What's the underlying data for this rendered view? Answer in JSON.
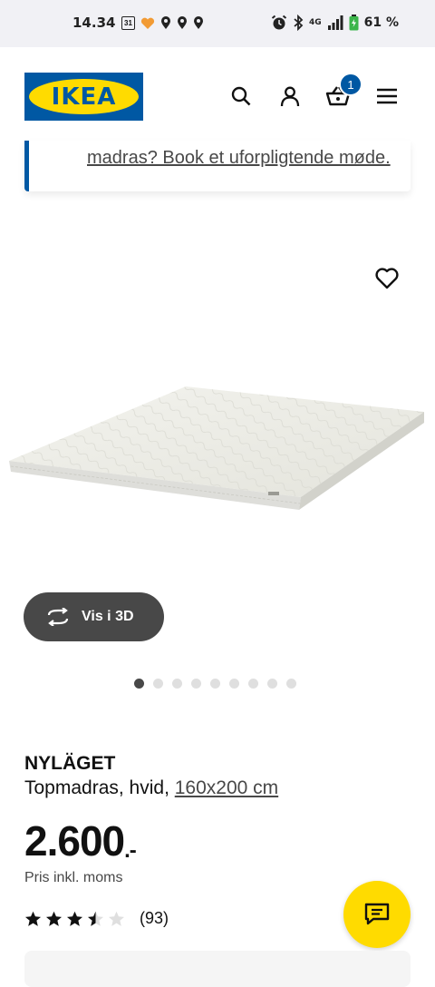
{
  "status_bar": {
    "time": "14.34",
    "calendar_day": "31",
    "battery": "61 %",
    "network": "4G",
    "icons": [
      "calendar-icon",
      "heart-app-icon",
      "location-icon",
      "location-icon",
      "location-icon",
      "alarm-icon",
      "bluetooth-icon",
      "signal-icon",
      "battery-icon"
    ]
  },
  "header": {
    "logo_text": "IKEA",
    "cart_count": "1",
    "icons": [
      "search-icon",
      "profile-icon",
      "cart-icon",
      "menu-icon"
    ]
  },
  "promo": {
    "link_text": "madras? Book et uforpligtende møde."
  },
  "gallery": {
    "view3d_label": "Vis i 3D",
    "image_count": 9,
    "active_index": 0
  },
  "product": {
    "name": "NYLÄGET",
    "description": "Topmadras, hvid, ",
    "size": "160x200 cm",
    "price_main": "2.600",
    "price_suffix": ".-",
    "vat_note": "Pris inkl. moms",
    "rating_value": 3.5,
    "rating_max": 5,
    "review_count": "(93)"
  },
  "colors": {
    "ikea_blue": "#0058a3",
    "ikea_yellow": "#ffdb00",
    "dark_gray": "#484848"
  }
}
